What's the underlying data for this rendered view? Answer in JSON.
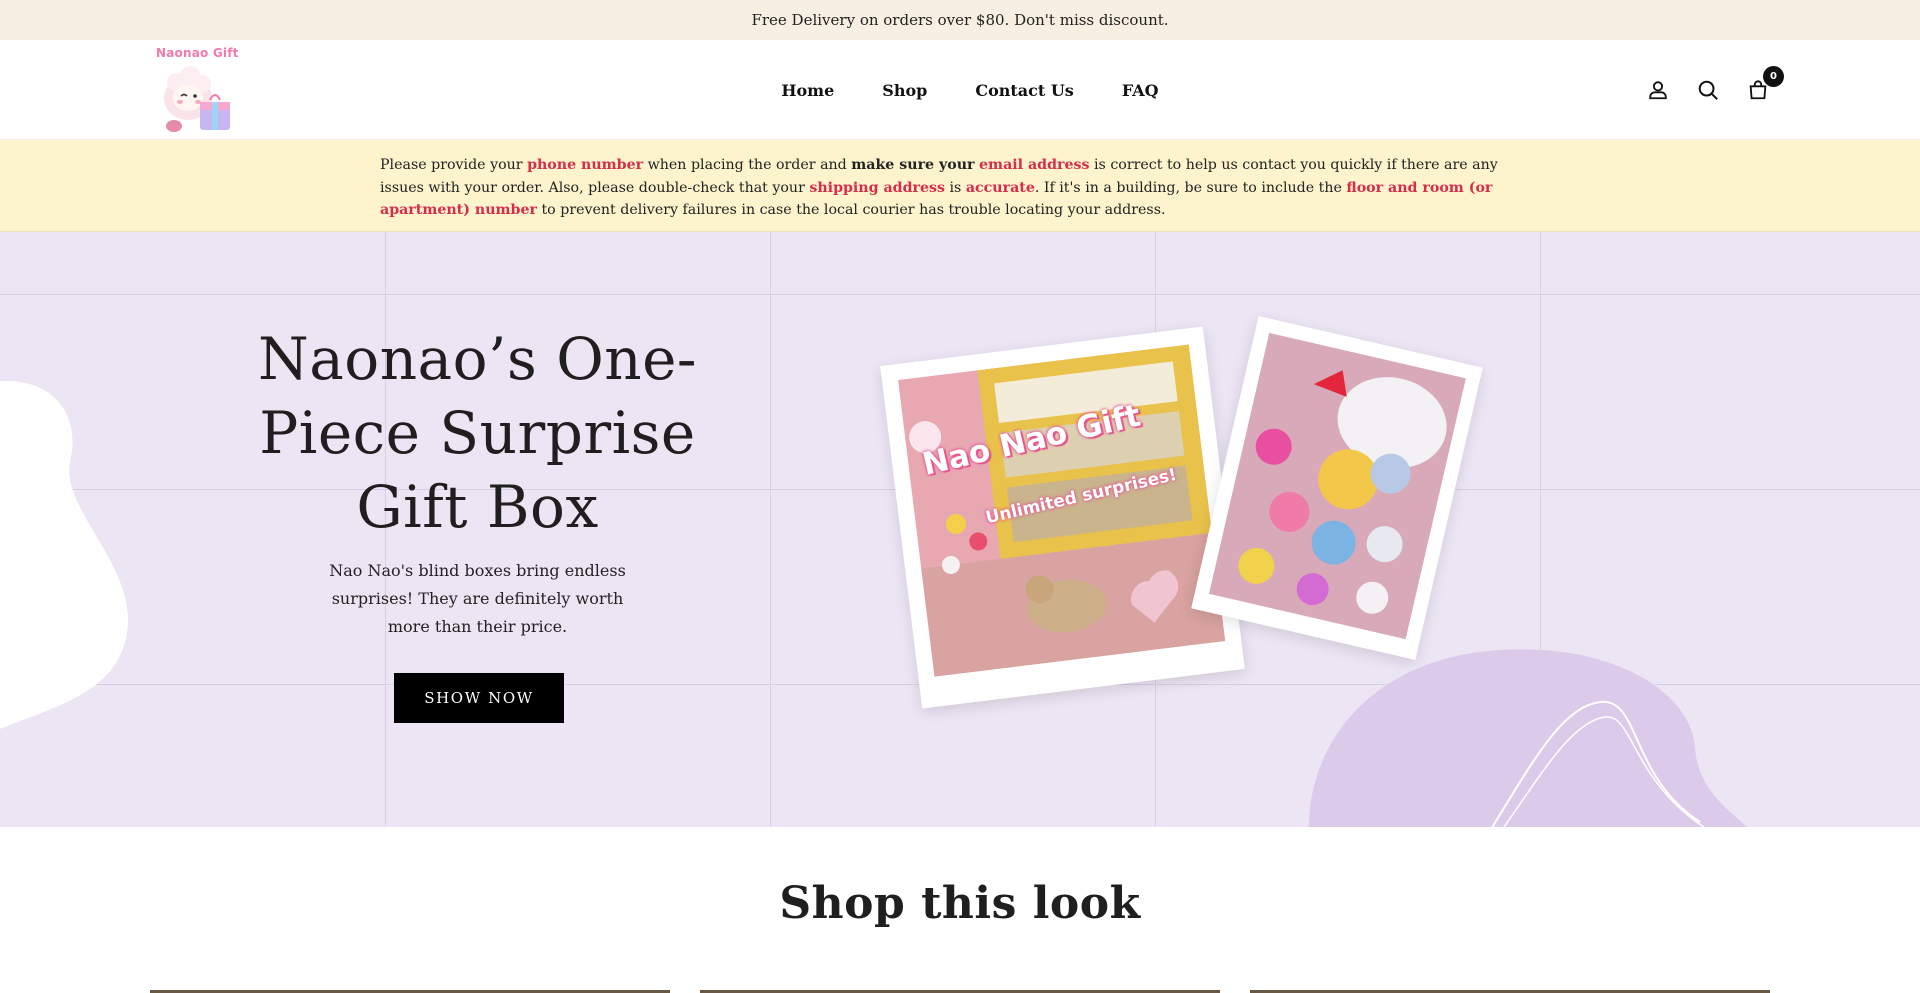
{
  "announcement": {
    "text": "Free Delivery on orders over $80. Don't miss discount."
  },
  "header": {
    "logo_text": "Naonao Gift",
    "nav": [
      {
        "label": "Home"
      },
      {
        "label": "Shop"
      },
      {
        "label": "Contact Us"
      },
      {
        "label": "FAQ"
      }
    ],
    "icons": [
      "account-icon",
      "search-icon",
      "cart-icon"
    ],
    "cart_count": "0"
  },
  "notice": {
    "p1": "Please provide your ",
    "phone": "phone number",
    "p2": " when placing the order and ",
    "make_sure": "make sure your",
    "p3": " ",
    "email": "email address",
    "p4": " is correct to help us contact you quickly if there are any issues with your order. Also, please double-check that your ",
    "shipping": "shipping address",
    "p5": " is ",
    "accurate": "accurate",
    "p6": ". If it's in a building, be sure to include the ",
    "floor": "floor and room (or apartment) number",
    "p7": " to prevent delivery failures in case the local courier has trouble locating your address."
  },
  "hero": {
    "title": "Naonao’s One-Piece Surprise Gift Box",
    "subtitle": "Nao Nao's blind boxes bring endless surprises! They are definitely worth more than their price.",
    "button": "SHOW NOW",
    "photo1_title": "Nao Nao Gift",
    "photo1_sub": "Unlimited surprises!"
  },
  "section": {
    "title": "Shop this look"
  },
  "colors": {
    "accent_red": "#d72c4b",
    "hero_bg": "#ece5f4",
    "notice_bg": "#fdf3cc",
    "announce_bg": "#f7efe2"
  }
}
